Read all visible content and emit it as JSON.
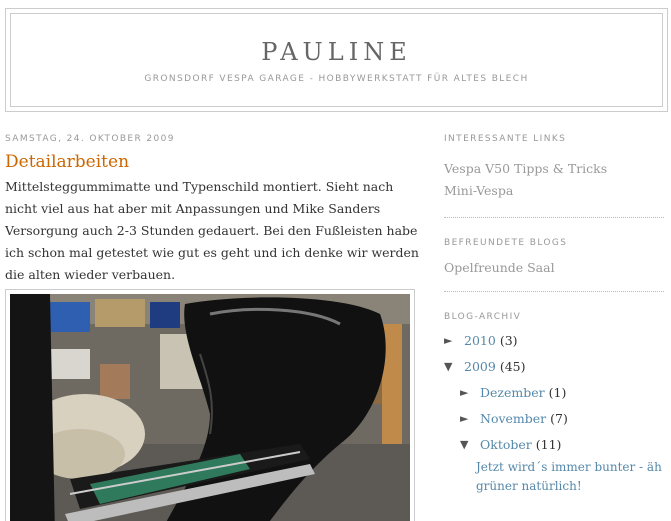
{
  "header": {
    "title": "PAULINE",
    "description": "Gronsdorf Vespa Garage - Hobbywerkstatt für altes Blech"
  },
  "post": {
    "date": "Samstag, 24. Oktober 2009",
    "title": "Detailarbeiten",
    "body": "Mittelsteggummimatte und Typenschild montiert. Sieht nach nicht viel aus hat aber mit Anpassungen und Mike Sanders Versorgung auch 2-3 Stunden gedauert. Bei den Fußleisten habe ich schon mal getestet wie gut es geht und ich denke wir werden die alten wieder verbauen."
  },
  "sidebar": {
    "links_heading": "Interessante Links",
    "links": [
      "Vespa V50 Tipps & Tricks",
      "Mini-Vespa"
    ],
    "friends_heading": "Befreundete Blogs",
    "friends": [
      "Opelfreunde Saal"
    ],
    "archive_heading": "Blog-Archiv",
    "archive": {
      "y2010": {
        "toggle": "►",
        "label": "2010",
        "count": "(3)"
      },
      "y2009": {
        "toggle": "▼",
        "label": "2009",
        "count": "(45)"
      },
      "dez": {
        "toggle": "►",
        "label": "Dezember",
        "count": "(1)"
      },
      "nov": {
        "toggle": "►",
        "label": "November",
        "count": "(7)"
      },
      "okt": {
        "toggle": "▼",
        "label": "Oktober",
        "count": "(11)"
      },
      "post_line1": "Jetzt wird´s immer bunter - äh",
      "post_line2": "grüner natürlich!"
    }
  },
  "colors": {
    "title_orange": "#cc6600",
    "link_blue": "#5588aa",
    "muted_grey": "#999999"
  }
}
